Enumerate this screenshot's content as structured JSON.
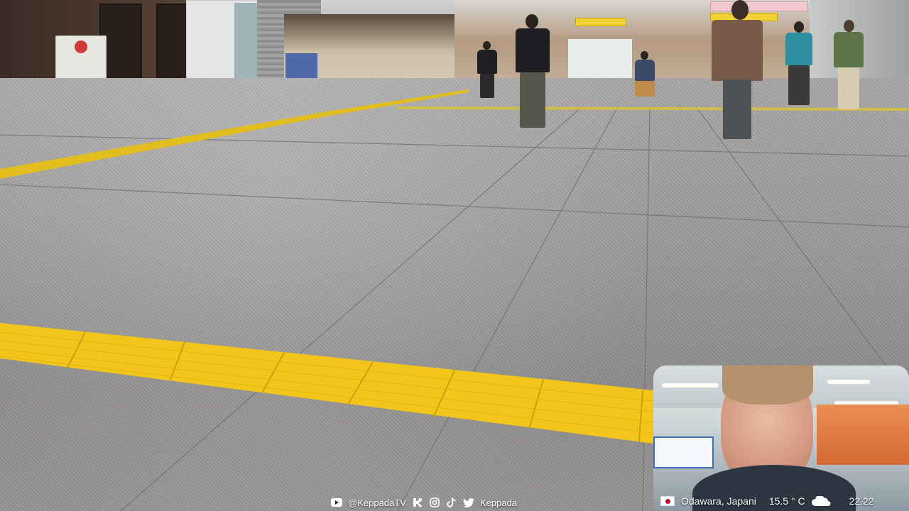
{
  "video": {
    "scene": "train station concourse"
  },
  "overlay": {
    "socials": {
      "youtube_handle": "@KeppadaTV",
      "twitter_handle": "Keppada"
    },
    "location": {
      "city": "Odawara, Japani",
      "temperature": "15.5 ° C",
      "weather_icon": "cloud-icon",
      "time": "22.22",
      "flag_icon": "japan-flag-icon"
    }
  },
  "colors": {
    "tactile_paving": "#f2c51a",
    "text": "#ffffff"
  }
}
